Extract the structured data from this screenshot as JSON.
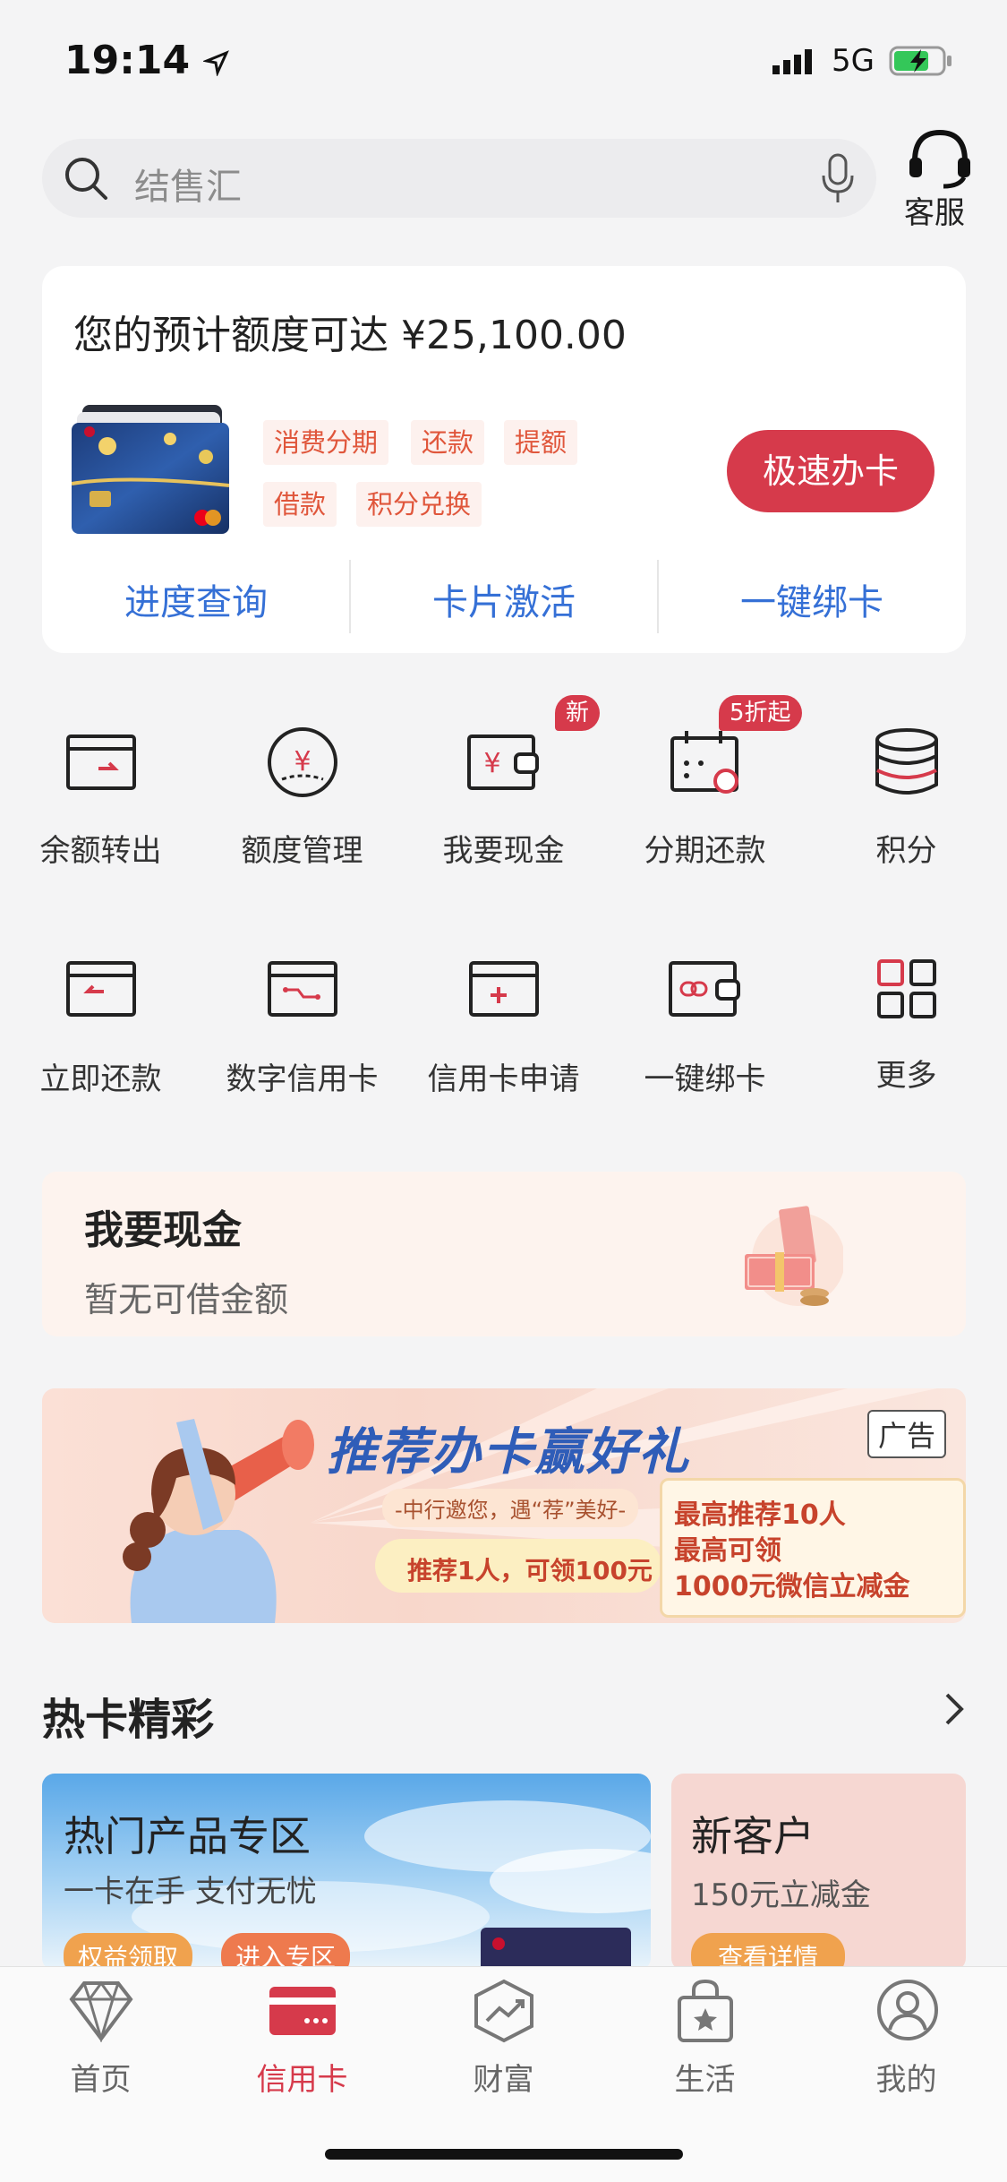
{
  "status": {
    "time": "19:14",
    "network": "5G"
  },
  "search": {
    "placeholder": "结售汇"
  },
  "customer_service": {
    "label": "客服"
  },
  "credit_card": {
    "title": "您的预计额度可达 ¥25,100.00",
    "tags": [
      "消费分期",
      "还款",
      "提额",
      "借款",
      "积分兑换"
    ],
    "apply_button": "极速办卡",
    "links": [
      "进度查询",
      "卡片激活",
      "一键绑卡"
    ]
  },
  "grid": {
    "items": [
      {
        "label": "余额转出",
        "icon": "balance-transfer-icon"
      },
      {
        "label": "额度管理",
        "icon": "limit-management-icon"
      },
      {
        "label": "我要现金",
        "icon": "cash-wallet-icon",
        "badge": "新"
      },
      {
        "label": "分期还款",
        "icon": "installment-calendar-icon",
        "badge": "5折起"
      },
      {
        "label": "积分",
        "icon": "points-stack-icon"
      },
      {
        "label": "立即还款",
        "icon": "repay-now-icon"
      },
      {
        "label": "数字信用卡",
        "icon": "digital-card-icon"
      },
      {
        "label": "信用卡申请",
        "icon": "card-apply-icon"
      },
      {
        "label": "一键绑卡",
        "icon": "bind-card-icon"
      },
      {
        "label": "更多",
        "icon": "more-grid-icon"
      }
    ]
  },
  "cash_section": {
    "title": "我要现金",
    "subtitle": "暂无可借金额"
  },
  "banner": {
    "title": "推荐办卡赢好礼",
    "ad_label": "广告",
    "slogan": "-中行邀您，遇“荐”美好-",
    "reward1": "推荐1人，可领100元",
    "reward2_line1": "最高推荐10人",
    "reward2_line2": "最高可领",
    "reward2_line3": "1000元微信立减金"
  },
  "hot_cards": {
    "title": "热卡精彩",
    "card1": {
      "title": "热门产品专区",
      "subtitle": "一卡在手 支付无忧",
      "buttons": [
        "权益领取",
        "进入专区"
      ]
    },
    "card2": {
      "title": "新客户",
      "subtitle": "150元立减金",
      "button": "查看详情"
    }
  },
  "tabbar": {
    "items": [
      {
        "label": "首页",
        "icon": "diamond-icon"
      },
      {
        "label": "信用卡",
        "icon": "credit-card-icon"
      },
      {
        "label": "财富",
        "icon": "wealth-chart-icon"
      },
      {
        "label": "生活",
        "icon": "shopping-bag-icon"
      },
      {
        "label": "我的",
        "icon": "profile-icon"
      }
    ],
    "active_index": 1
  },
  "colors": {
    "accent": "#d63a4b",
    "link": "#3570d6",
    "tag_text": "#e0563b"
  }
}
